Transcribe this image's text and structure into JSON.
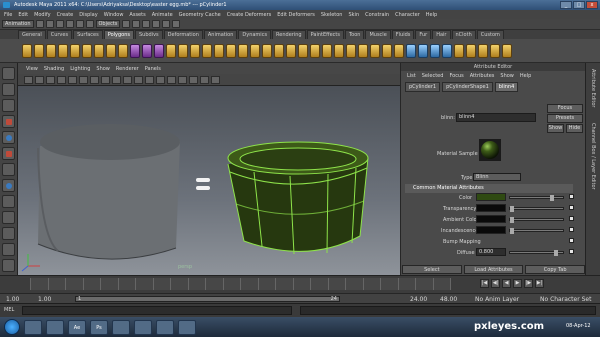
{
  "window": {
    "title": "Autodesk Maya 2011 x64: C:\\Users\\Adriyaksa\\Desktop\\easter egg.mb* --- pCylinder1",
    "min": "_",
    "max": "□",
    "close": "x"
  },
  "menubar": [
    "File",
    "Edit",
    "Modify",
    "Create",
    "Display",
    "Window",
    "Assets",
    "Animate",
    "Geometry Cache",
    "Create Deformers",
    "Edit Deformers",
    "Skeleton",
    "Skin",
    "Constrain",
    "Character",
    "Help"
  ],
  "status": {
    "mode": "Animation",
    "select_mode": "Objects"
  },
  "shelf_tabs": [
    "General",
    "Curves",
    "Surfaces",
    "Polygons",
    "Subdivs",
    "Deformation",
    "Animation",
    "Dynamics",
    "Rendering",
    "PaintEffects",
    "Toon",
    "Muscle",
    "Fluids",
    "Fur",
    "Hair",
    "nCloth",
    "Custom"
  ],
  "shelf_active": "Polygons",
  "viewport": {
    "menu": [
      "View",
      "Shading",
      "Lighting",
      "Show",
      "Renderer",
      "Panels"
    ],
    "panel_label": "persp"
  },
  "attribute_editor": {
    "title": "Attribute Editor",
    "menu": [
      "List",
      "Selected",
      "Focus",
      "Attributes",
      "Show",
      "Help"
    ],
    "tabs": [
      "pCylinder1",
      "pCylinderShape1",
      "blinn4"
    ],
    "active_tab": "blinn4",
    "node_label": "blinn:",
    "node_value": "blinn4",
    "focus": "Focus",
    "presets": "Presets",
    "show": "Show",
    "hide": "Hide",
    "material_sample": "Material Sample",
    "type_label": "Type",
    "type_value": "Blinn",
    "section": "Common Material Attributes",
    "attrs": [
      {
        "label": "Color",
        "value": ""
      },
      {
        "label": "Transparency",
        "value": ""
      },
      {
        "label": "Ambient Color",
        "value": ""
      },
      {
        "label": "Incandescence",
        "value": ""
      },
      {
        "label": "Bump Mapping",
        "value": ""
      },
      {
        "label": "Diffuse",
        "value": "0.800"
      }
    ],
    "buttons": [
      "Select",
      "Load Attributes",
      "Copy Tab"
    ],
    "colors": {
      "color": "#2f4a12",
      "swatch": "#0a0a0a"
    }
  },
  "side_tabs": [
    "Channel Box / Layer Editor",
    "Attribute Editor"
  ],
  "timeline": {
    "start": "1.00",
    "current": "1.00",
    "range_start": "1",
    "range_end": "24",
    "end_a": "24.00",
    "end_b": "48.00",
    "anim_layer": "No Anim Layer",
    "char_set": "No Character Set"
  },
  "cmdline": {
    "label": "MEL"
  },
  "taskbar": {
    "apps": [
      "",
      "Ae",
      "Ps",
      "",
      "",
      "",
      "",
      ""
    ],
    "clock": "08-Apr-12"
  },
  "watermark": "pxleyes.com"
}
